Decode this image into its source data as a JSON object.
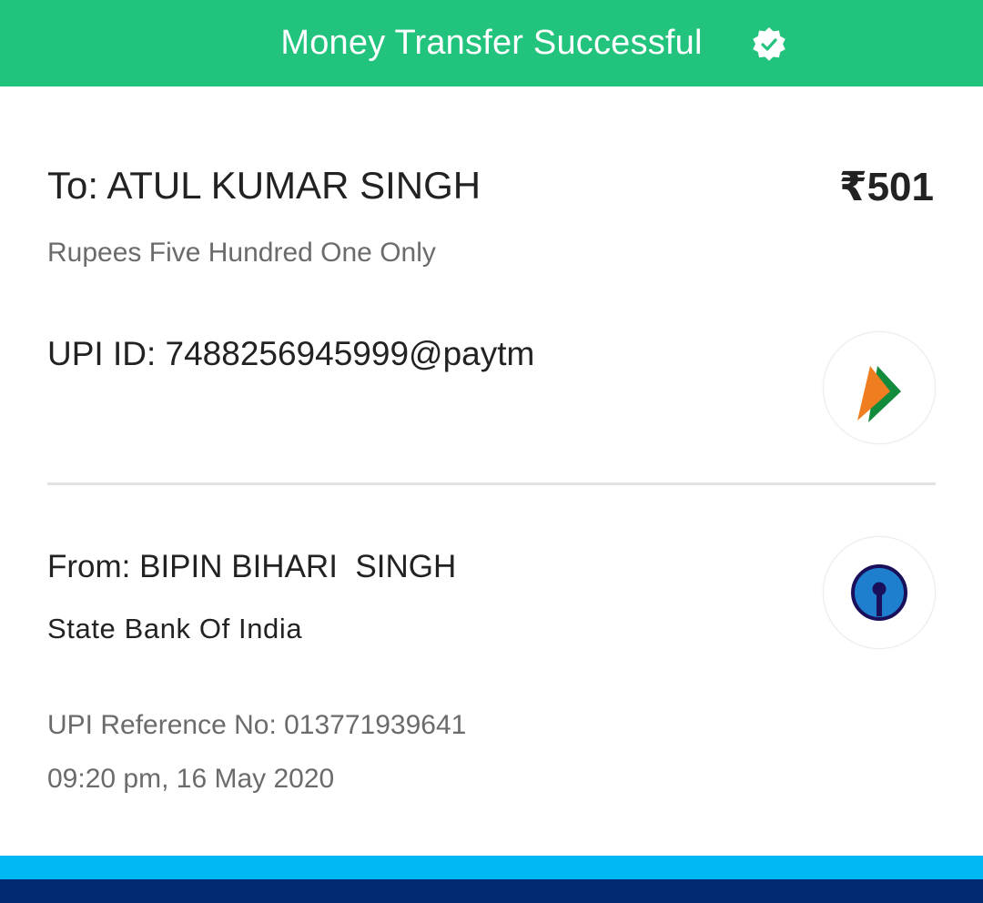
{
  "header": {
    "title": "Money Transfer Successful",
    "icon": "verified-badge-icon",
    "color": "#22c37c"
  },
  "recipient": {
    "to_label": "To: ATUL KUMAR SINGH",
    "amount": "₹501",
    "amount_words": "Rupees Five Hundred One Only",
    "upi_id": "UPI ID: 7488256945999@paytm",
    "logo_icon": "bhim-upi-icon"
  },
  "sender": {
    "from_label": "From: BIPIN BIHARI  SINGH",
    "bank": "State Bank Of India",
    "logo_icon": "sbi-icon"
  },
  "transaction": {
    "reference": "UPI Reference No: 013771939641",
    "datetime": "09:20 pm, 16 May 2020"
  },
  "footer": {
    "light_color": "#00b8f1",
    "dark_color": "#012a72"
  }
}
